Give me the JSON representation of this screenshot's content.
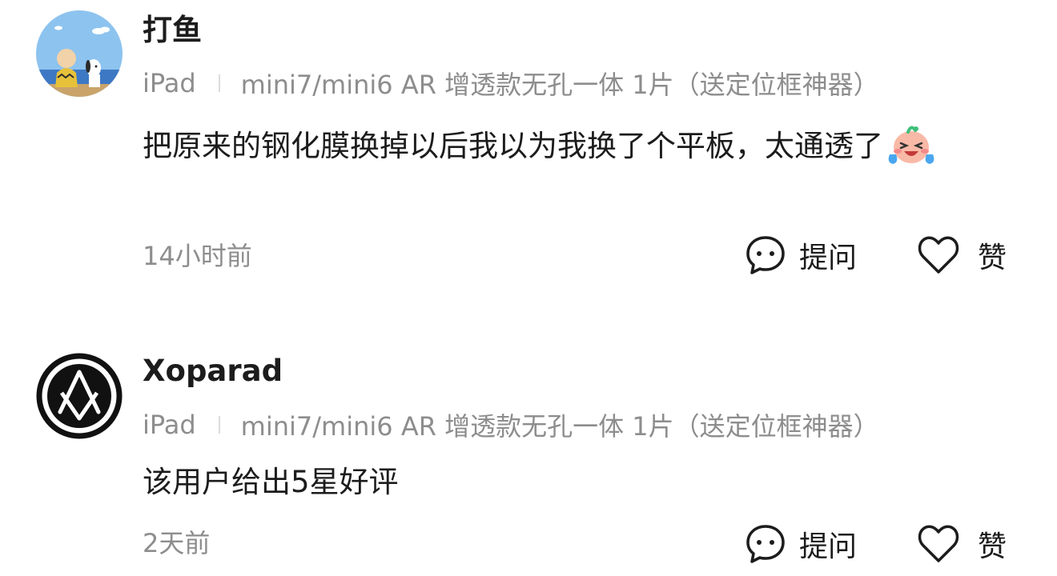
{
  "reviews": [
    {
      "username": "打鱼",
      "device": "iPad",
      "product": "mini7/mini6 AR 增透款无孔一体 1片（送定位框神器）",
      "body": "把原来的钢化膜换掉以后我以为我换了个平板，太通透了",
      "emoji": "crying-laughing-emoji",
      "time": "14小时前",
      "ask_label": "提问",
      "like_label": "赞"
    },
    {
      "username": "Xoparad",
      "device": "iPad",
      "product": "mini7/mini6 AR 增透款无孔一体 1片（送定位框神器）",
      "body": "该用户给出5星好评",
      "time": "2天前",
      "ask_label": "提问",
      "like_label": "赞"
    }
  ],
  "icons": {
    "ask": "chat-bubble-icon",
    "like": "heart-icon"
  },
  "colors": {
    "text_primary": "#1c1c1c",
    "text_secondary": "#8d8d8d",
    "separator": "#dcdcdc",
    "background": "#ffffff"
  }
}
